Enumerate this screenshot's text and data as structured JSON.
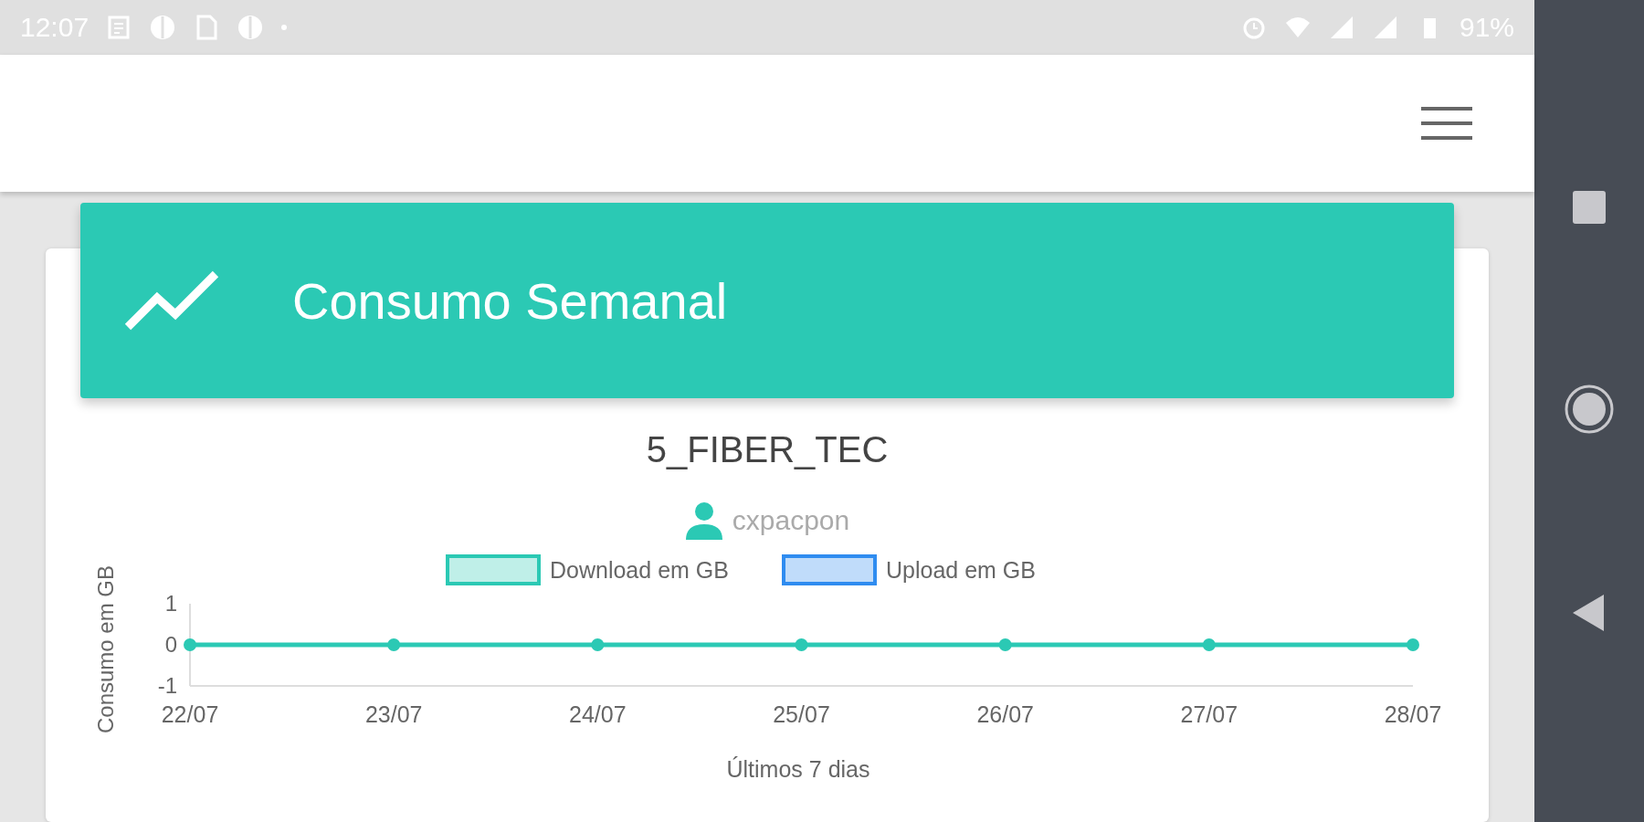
{
  "status_bar": {
    "time": "12:07",
    "battery": "91%"
  },
  "card": {
    "title": "Consumo Semanal",
    "device": "5_FIBER_TEC",
    "user": "cxpacpon",
    "chart_data": {
      "type": "line",
      "xlabel": "Últimos 7 dias",
      "ylabel": "Consumo em GB",
      "categories": [
        "22/07",
        "23/07",
        "24/07",
        "25/07",
        "26/07",
        "27/07",
        "28/07"
      ],
      "ylim": [
        -1,
        1
      ],
      "yticks": [
        -1,
        0,
        1
      ],
      "legend": true,
      "series": [
        {
          "name": "Download em GB",
          "color": "#2bc9b4",
          "marker": "circle",
          "values": [
            0,
            0,
            0,
            0,
            0,
            0,
            0
          ]
        },
        {
          "name": "Upload em GB",
          "color": "#2f8cf0",
          "values": [
            null,
            null,
            null,
            null,
            null,
            null,
            null
          ]
        }
      ]
    }
  }
}
